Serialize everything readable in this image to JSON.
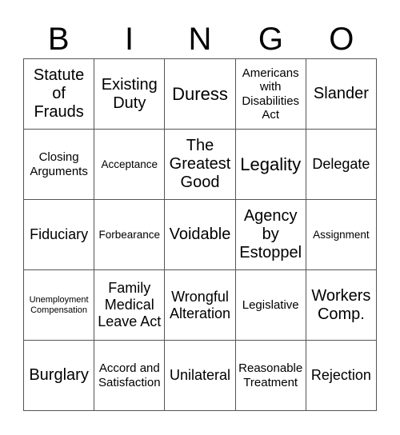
{
  "header": [
    "B",
    "I",
    "N",
    "G",
    "O"
  ],
  "cells": [
    {
      "text": "Statute of Frauds",
      "lines": [
        "Statute",
        "of",
        "Frauds"
      ],
      "size": "s-l"
    },
    {
      "text": "Existing Duty",
      "lines": [
        "Existing",
        "Duty"
      ],
      "size": "s-l"
    },
    {
      "text": "Duress",
      "lines": [
        "Duress"
      ],
      "size": "s-xl"
    },
    {
      "text": "Americans with Disabilities Act",
      "lines": [
        "Americans",
        "with",
        "Disabilities",
        "Act"
      ],
      "size": "s-s"
    },
    {
      "text": "Slander",
      "lines": [
        "Slander"
      ],
      "size": "s-l"
    },
    {
      "text": "Closing Arguments",
      "lines": [
        "Closing",
        "Arguments"
      ],
      "size": "s-s"
    },
    {
      "text": "Acceptance",
      "lines": [
        "Acceptance"
      ],
      "size": "s-xs"
    },
    {
      "text": "The Greatest Good",
      "lines": [
        "The",
        "Greatest",
        "Good"
      ],
      "size": "s-l"
    },
    {
      "text": "Legality",
      "lines": [
        "Legality"
      ],
      "size": "s-xl"
    },
    {
      "text": "Delegate",
      "lines": [
        "Delegate"
      ],
      "size": "s-m"
    },
    {
      "text": "Fiduciary",
      "lines": [
        "Fiduciary"
      ],
      "size": "s-m"
    },
    {
      "text": "Forbearance",
      "lines": [
        "Forbearance"
      ],
      "size": "s-xs"
    },
    {
      "text": "Voidable",
      "lines": [
        "Voidable"
      ],
      "size": "s-l"
    },
    {
      "text": "Agency by Estoppel",
      "lines": [
        "Agency",
        "by",
        "Estoppel"
      ],
      "size": "s-l"
    },
    {
      "text": "Assignment",
      "lines": [
        "Assignment"
      ],
      "size": "s-xs"
    },
    {
      "text": "Unemployment Compensation",
      "lines": [
        "Unemployment",
        "Compensation"
      ],
      "size": "s-xxs"
    },
    {
      "text": "Family Medical Leave Act",
      "lines": [
        "Family",
        "Medical",
        "Leave Act"
      ],
      "size": "s-m"
    },
    {
      "text": "Wrongful Alteration",
      "lines": [
        "Wrongful",
        "Alteration"
      ],
      "size": "s-m"
    },
    {
      "text": "Legislative",
      "lines": [
        "Legislative"
      ],
      "size": "s-s"
    },
    {
      "text": "Workers Comp.",
      "lines": [
        "Workers",
        "Comp."
      ],
      "size": "s-l"
    },
    {
      "text": "Burglary",
      "lines": [
        "Burglary"
      ],
      "size": "s-l"
    },
    {
      "text": "Accord and Satisfaction",
      "lines": [
        "Accord and",
        "Satisfaction"
      ],
      "size": "s-s"
    },
    {
      "text": "Unilateral",
      "lines": [
        "Unilateral"
      ],
      "size": "s-m"
    },
    {
      "text": "Reasonable Treatment",
      "lines": [
        "Reasonable",
        "Treatment"
      ],
      "size": "s-s"
    },
    {
      "text": "Rejection",
      "lines": [
        "Rejection"
      ],
      "size": "s-m"
    }
  ]
}
